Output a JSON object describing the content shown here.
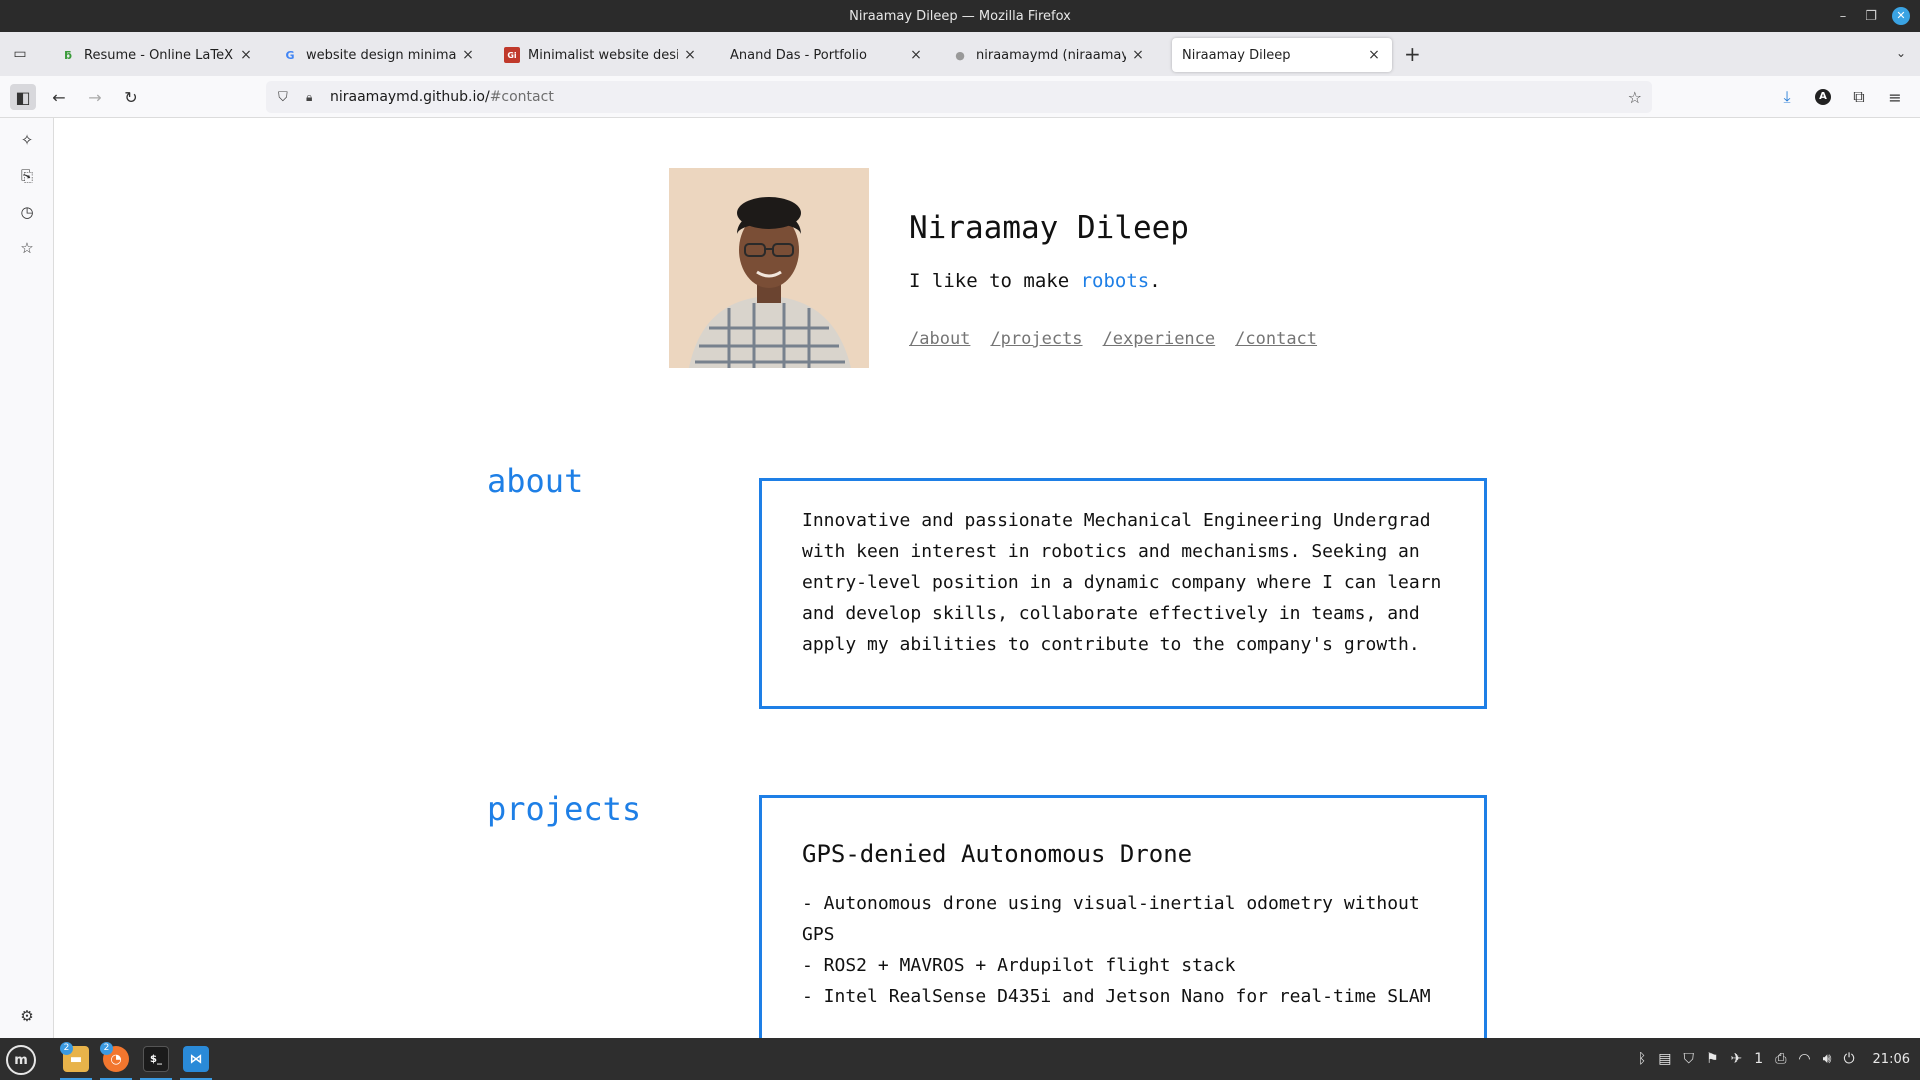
{
  "window": {
    "title": "Niraamay Dileep — Mozilla Firefox"
  },
  "tabs": [
    {
      "label": "Resume - Online LaTeX Edit",
      "favicon": "overleaf-icon",
      "active": false
    },
    {
      "label": "website design minimalistic",
      "favicon": "google-icon",
      "active": false
    },
    {
      "label": "Minimalist website design: p",
      "favicon": "site-icon",
      "active": false
    },
    {
      "label": "Anand Das - Portfolio",
      "favicon": "",
      "active": false
    },
    {
      "label": "niraamaymd (niraamaymd) /",
      "favicon": "github-icon",
      "active": false
    },
    {
      "label": "Niraamay Dileep",
      "favicon": "",
      "active": true
    }
  ],
  "url": {
    "host": "niraamaymd.github.io/",
    "path": "#contact"
  },
  "profile": {
    "name": "Niraamay Dileep",
    "tagline_prefix": "I like to make ",
    "tagline_highlight": "robots",
    "tagline_suffix": ".",
    "nav": [
      "/about",
      "/projects",
      "/experience",
      "/contact"
    ]
  },
  "about": {
    "title": "about",
    "text": "Innovative and passionate Mechanical Engineering Undergrad with keen interest in robotics and mechanisms. Seeking an entry-level position in a dynamic company where I can learn and develop skills, collaborate effectively in teams, and apply my abilities to contribute to the company's growth."
  },
  "projects": {
    "title": "projects",
    "items": [
      {
        "title": "GPS-denied Autonomous Drone",
        "lines": [
          "- Autonomous drone using visual-inertial odometry without GPS",
          "- ROS2 + MAVROS + Ardupilot flight stack",
          "- Intel RealSense D435i and Jetson Nano for real-time SLAM"
        ]
      }
    ]
  },
  "taskbar": {
    "apps": [
      {
        "name": "files",
        "badge": "2",
        "color": "#e8b34a"
      },
      {
        "name": "firefox",
        "badge": "2",
        "color": "#f2762e"
      },
      {
        "name": "terminal",
        "badge": "",
        "color": "#1b1b1b"
      },
      {
        "name": "vscode",
        "badge": "",
        "color": "#2a8ad8"
      }
    ],
    "notification_count": "1",
    "clock": "21:06"
  },
  "colors": {
    "accent": "#1e7fe6",
    "link": "#757575"
  }
}
